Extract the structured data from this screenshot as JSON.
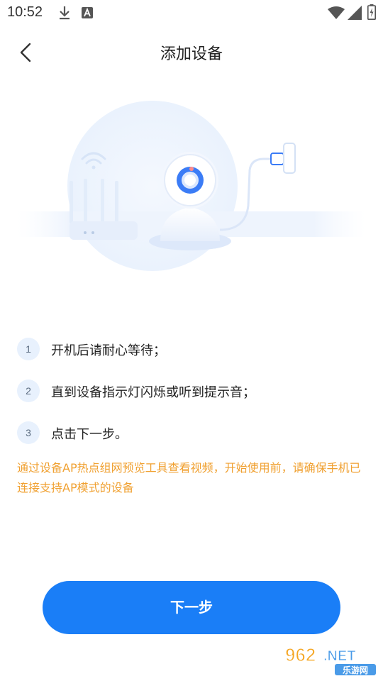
{
  "status_bar": {
    "time": "10:52",
    "icons": [
      "download-icon",
      "text-a-icon",
      "wifi-icon",
      "signal-icon",
      "battery-icon"
    ]
  },
  "header": {
    "back_icon": "chevron-left-icon",
    "title": "添加设备"
  },
  "illustration": {
    "description_icons": [
      "router-icon",
      "camera-icon",
      "power-adapter-icon"
    ],
    "accent_color": "#3b7cf6"
  },
  "steps": [
    {
      "number": "1",
      "text": "开机后请耐心等待；"
    },
    {
      "number": "2",
      "text": "直到设备指示灯闪烁或听到提示音；"
    },
    {
      "number": "3",
      "text": "点击下一步。"
    }
  ],
  "notice": "通过设备AP热点组网预览工具查看视频，开始使用前，请确保手机已连接支持AP模式的设备",
  "next_button": {
    "label": "下一步",
    "color": "#1a7ef7"
  },
  "watermark": {
    "main": "962.NET",
    "sub": "乐游网"
  },
  "colors": {
    "notice": "#f0a030",
    "step_badge_bg": "#e8f1fd",
    "primary": "#1a7ef7"
  }
}
